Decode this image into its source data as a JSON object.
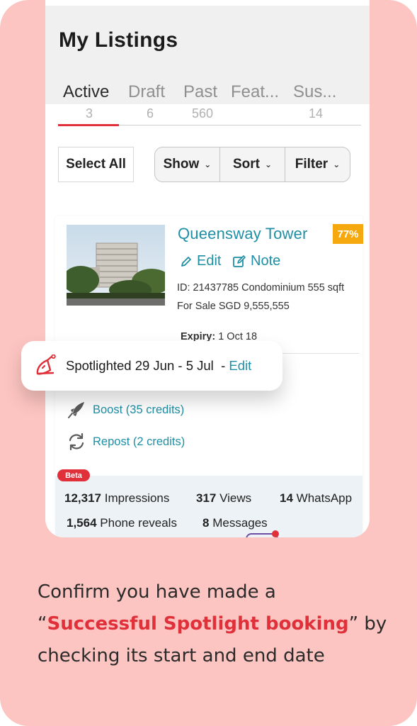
{
  "header": {
    "title": "My Listings"
  },
  "tabs": [
    {
      "label": "Active",
      "count": "3"
    },
    {
      "label": "Draft",
      "count": "6"
    },
    {
      "label": "Past",
      "count": "560"
    },
    {
      "label": "Feat...",
      "count": ""
    },
    {
      "label": "Sus...",
      "count": "14"
    }
  ],
  "toolbar": {
    "select_all": "Select All",
    "show": "Show",
    "sort": "Sort",
    "filter": "Filter"
  },
  "listing": {
    "title": "Queensway Tower",
    "score": "77%",
    "edit": "Edit",
    "note": "Note",
    "meta_line1": "ID: 21437785 Condominium 555 sqft",
    "meta_line2": "For Sale SGD 9,555,555",
    "expiry_label": "Expiry:",
    "expiry_value": "1 Oct 18",
    "boost": "Boost (35 credits)",
    "repost": "Repost (2 credits)",
    "beta": "Beta",
    "stats": {
      "impressions_value": "12,317",
      "impressions_label": "Impressions",
      "views_value": "317",
      "views_label": "Views",
      "whatsapp_value": "14",
      "whatsapp_label": "WhatsApp",
      "phone_value": "1,564",
      "phone_label": "Phone reveals",
      "messages_value": "8",
      "messages_label": "Messages"
    }
  },
  "toast": {
    "text": "Spotlighted 29 Jun - 5 Jul",
    "separator": "-",
    "link": "Edit"
  },
  "caption": {
    "line1": "Confirm you have made a",
    "open_quote": "“",
    "highlight": "Successful Spotlight booking",
    "close_quote": "” by",
    "line3": "checking its start and end date"
  },
  "colors": {
    "background": "#fdc5c1",
    "accent_red": "#e0303a",
    "link_teal": "#1f8fa6",
    "badge_orange": "#f6a80f"
  }
}
